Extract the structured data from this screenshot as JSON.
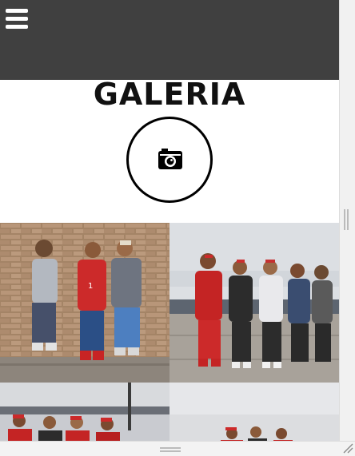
{
  "header": {
    "menu_icon": "hamburger-menu-icon",
    "background_color": "#404040"
  },
  "page": {
    "title": "GALERIA",
    "title_icon": "camera-icon"
  },
  "gallery": {
    "photos": [
      {
        "description": "three-men-standing-by-brick-wall"
      },
      {
        "description": "five-men-in-red-caps-outdoors"
      },
      {
        "description": "group-with-red-caps-under-cloudy-sky"
      },
      {
        "description": "group-outdoors-overcast-sky"
      }
    ]
  },
  "window": {
    "resize_handles": [
      "vertical-resize-handle",
      "horizontal-resize-handle",
      "corner-resize-grip"
    ]
  }
}
